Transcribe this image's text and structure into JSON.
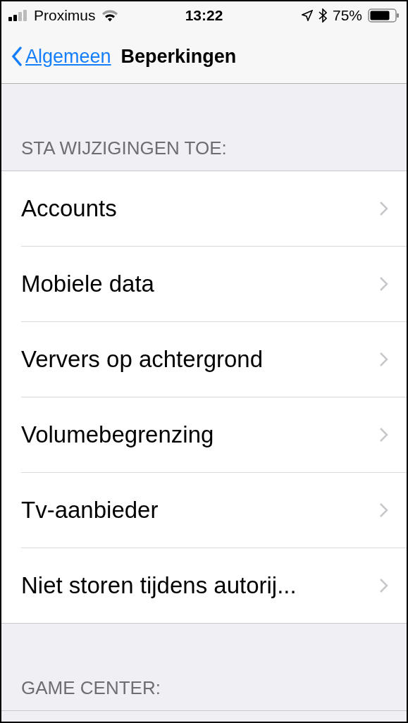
{
  "status_bar": {
    "carrier": "Proximus",
    "time": "13:22",
    "battery": "75%"
  },
  "nav": {
    "back": "Algemeen",
    "title": "Beperkingen"
  },
  "sections": [
    {
      "header": "STA WIJZIGINGEN TOE:",
      "items": [
        {
          "label": "Accounts"
        },
        {
          "label": "Mobiele data"
        },
        {
          "label": "Ververs op achtergrond"
        },
        {
          "label": "Volumebegrenzing"
        },
        {
          "label": "Tv-aanbieder"
        },
        {
          "label": "Niet storen tijdens autorij..."
        }
      ]
    },
    {
      "header": "GAME CENTER:"
    }
  ]
}
